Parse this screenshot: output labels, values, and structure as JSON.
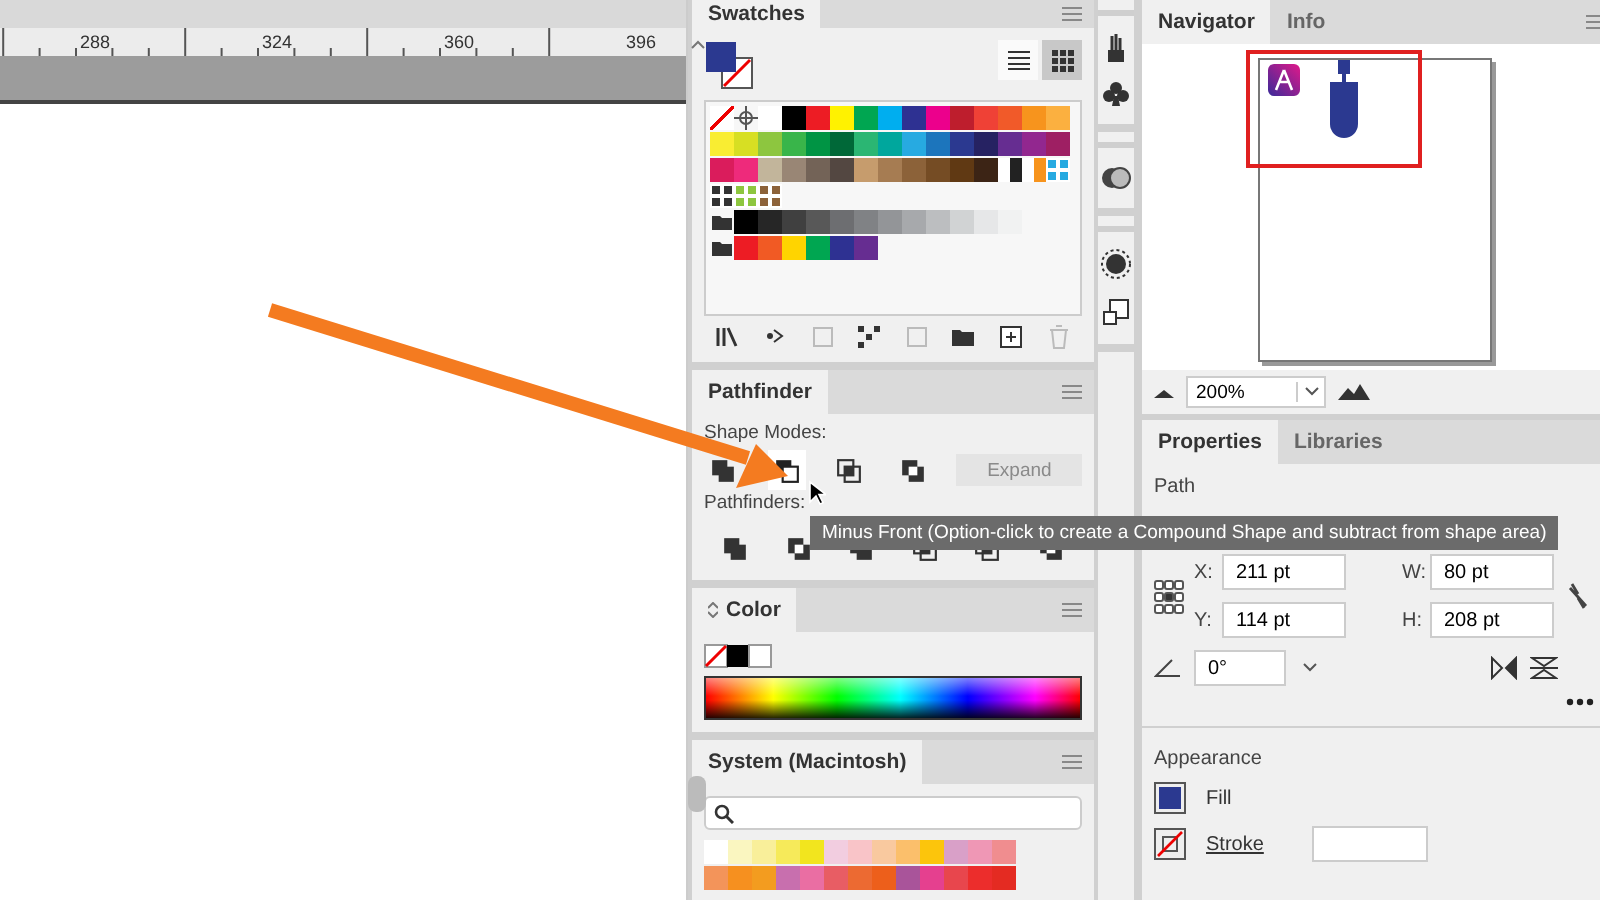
{
  "ruler": {
    "labels": [
      "288",
      "324",
      "360",
      "396"
    ]
  },
  "swatches": {
    "tab": "Swatches",
    "fill": {
      "color": "#2b3990"
    },
    "views": [
      {
        "kind": "list",
        "selected": false
      },
      {
        "kind": "grid",
        "selected": true
      }
    ],
    "rows": [
      [
        {
          "kind": "none"
        },
        {
          "kind": "registration"
        },
        {
          "kind": "color",
          "color": "#ffffff"
        },
        {
          "kind": "color",
          "color": "#000000"
        },
        {
          "kind": "color",
          "color": "#ed1c24"
        },
        {
          "kind": "color",
          "color": "#fff200"
        },
        {
          "kind": "color",
          "color": "#00a651"
        },
        {
          "kind": "color",
          "color": "#00aeef"
        },
        {
          "kind": "color",
          "color": "#2e3192"
        },
        {
          "kind": "color",
          "color": "#ec008c"
        },
        {
          "kind": "color",
          "color": "#be1e2d"
        },
        {
          "kind": "color",
          "color": "#ef4136"
        },
        {
          "kind": "color",
          "color": "#f15a29"
        },
        {
          "kind": "color",
          "color": "#f7941d"
        },
        {
          "kind": "color",
          "color": "#fbb040"
        }
      ],
      [
        {
          "kind": "color",
          "color": "#f9ed32"
        },
        {
          "kind": "color",
          "color": "#d7df23"
        },
        {
          "kind": "color",
          "color": "#8dc63f"
        },
        {
          "kind": "color",
          "color": "#39b54a"
        },
        {
          "kind": "color",
          "color": "#009444"
        },
        {
          "kind": "color",
          "color": "#006838"
        },
        {
          "kind": "color",
          "color": "#2bb673"
        },
        {
          "kind": "color",
          "color": "#00a79d"
        },
        {
          "kind": "color",
          "color": "#27aae1"
        },
        {
          "kind": "color",
          "color": "#1c75bc"
        },
        {
          "kind": "color",
          "color": "#2b3990"
        },
        {
          "kind": "color",
          "color": "#262262"
        },
        {
          "kind": "color",
          "color": "#662d91"
        },
        {
          "kind": "color",
          "color": "#92278f"
        },
        {
          "kind": "color",
          "color": "#9e1f63"
        }
      ],
      [
        {
          "kind": "color",
          "color": "#da1c5c"
        },
        {
          "kind": "color",
          "color": "#ee2a7b"
        },
        {
          "kind": "color",
          "color": "#c2b59b"
        },
        {
          "kind": "color",
          "color": "#998675"
        },
        {
          "kind": "color",
          "color": "#736357"
        },
        {
          "kind": "color",
          "color": "#534741"
        },
        {
          "kind": "color",
          "color": "#c69c6d"
        },
        {
          "kind": "color",
          "color": "#a67c52"
        },
        {
          "kind": "color",
          "color": "#8c6239"
        },
        {
          "kind": "color",
          "color": "#754c24"
        },
        {
          "kind": "color",
          "color": "#603913"
        },
        {
          "kind": "color",
          "color": "#3c2415"
        },
        {
          "kind": "gradient",
          "color": "#222222"
        },
        {
          "kind": "gradient",
          "color": "#f7941d"
        },
        {
          "kind": "pattern",
          "color": "#27aae1"
        }
      ],
      [
        {
          "kind": "pattern",
          "color": "#333333"
        },
        {
          "kind": "pattern",
          "color": "#8dc63f"
        },
        {
          "kind": "pattern",
          "color": "#8c6239"
        }
      ],
      [
        {
          "kind": "folder"
        },
        {
          "kind": "color",
          "color": "#000000"
        },
        {
          "kind": "color",
          "color": "#262626"
        },
        {
          "kind": "color",
          "color": "#404040"
        },
        {
          "kind": "color",
          "color": "#585858"
        },
        {
          "kind": "color",
          "color": "#6d6e71"
        },
        {
          "kind": "color",
          "color": "#808285"
        },
        {
          "kind": "color",
          "color": "#939598"
        },
        {
          "kind": "color",
          "color": "#a7a9ac"
        },
        {
          "kind": "color",
          "color": "#bcbec0"
        },
        {
          "kind": "color",
          "color": "#d1d3d4"
        },
        {
          "kind": "color",
          "color": "#e6e7e8"
        },
        {
          "kind": "color",
          "color": "#f1f2f2"
        }
      ],
      [
        {
          "kind": "folder"
        },
        {
          "kind": "color",
          "color": "#ed1c24"
        },
        {
          "kind": "color",
          "color": "#f15a24"
        },
        {
          "kind": "color",
          "color": "#ffd400"
        },
        {
          "kind": "color",
          "color": "#00a651"
        },
        {
          "kind": "color",
          "color": "#2e3192"
        },
        {
          "kind": "color",
          "color": "#662d91"
        }
      ]
    ]
  },
  "pathfinder": {
    "tab": "Pathfinder",
    "shape_modes_label": "Shape Modes:",
    "shape_modes": [
      {
        "highlighted": false
      },
      {
        "highlighted": true
      },
      {
        "highlighted": false
      },
      {
        "highlighted": false
      }
    ],
    "expand": {
      "label": "Expand",
      "disabled": true
    },
    "pathfinders_label": "Pathfinders:"
  },
  "tooltip": "Minus Front (Option-click to create a Compound Shape and subtract from shape area)",
  "color_panel": {
    "tab": "Color"
  },
  "system_swatches": {
    "tab": "System (Macintosh)",
    "rows": [
      [
        {
          "color": "#ffffff"
        },
        {
          "color": "#faf6c0"
        },
        {
          "color": "#f9ef9a"
        },
        {
          "color": "#f6ea5a"
        },
        {
          "color": "#f2e51e"
        },
        {
          "color": "#f2cde0"
        },
        {
          "color": "#f9c4c8"
        },
        {
          "color": "#f9c99f"
        },
        {
          "color": "#fbbf6b"
        },
        {
          "color": "#fcc50c"
        },
        {
          "color": "#d9a0c8"
        },
        {
          "color": "#ef97b5"
        },
        {
          "color": "#f08d8f"
        }
      ],
      [
        {
          "color": "#f3945a"
        },
        {
          "color": "#f6901f"
        },
        {
          "color": "#f39c1f"
        },
        {
          "color": "#c86fae"
        },
        {
          "color": "#ea6ea3"
        },
        {
          "color": "#e85d64"
        },
        {
          "color": "#ec6a32"
        },
        {
          "color": "#ed5f1b"
        },
        {
          "color": "#a9549a"
        },
        {
          "color": "#e5408f"
        },
        {
          "color": "#e8464d"
        },
        {
          "color": "#ec2d2c"
        },
        {
          "color": "#e42b22"
        }
      ]
    ]
  },
  "navigator": {
    "tabs": [
      {
        "label": "Navigator",
        "selected": true
      },
      {
        "label": "Info",
        "selected": false
      }
    ],
    "zoom": "200%"
  },
  "properties": {
    "tabs": [
      {
        "label": "Properties",
        "selected": true
      },
      {
        "label": "Libraries",
        "selected": false
      }
    ],
    "section": "Path",
    "fields": [
      {
        "label": "X:",
        "value": "211 pt"
      },
      {
        "label": "W:",
        "value": "80 pt"
      },
      {
        "label": "Y:",
        "value": "114 pt"
      },
      {
        "label": "H:",
        "value": "208 pt"
      }
    ],
    "rotate": "0°",
    "appearance": {
      "title": "Appearance",
      "fill_label": "Fill",
      "fill": {
        "color": "#2b3990"
      },
      "stroke_label": "Stroke"
    }
  }
}
